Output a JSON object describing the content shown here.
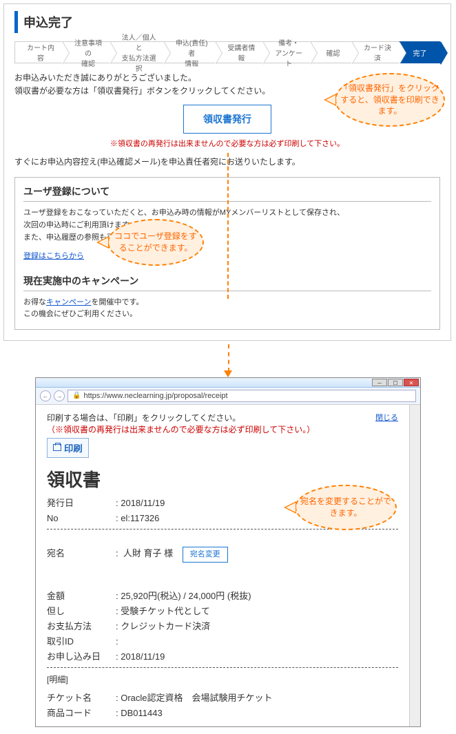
{
  "page": {
    "title": "申込完了"
  },
  "steps": [
    {
      "label": "カート内容"
    },
    {
      "label": "注意事項の\n確認"
    },
    {
      "label": "法人／個人と\n支払方法選択"
    },
    {
      "label": "申込(責任)者\n情報"
    },
    {
      "label": "受講者情報"
    },
    {
      "label": "備考・\nアンケート"
    },
    {
      "label": "確認"
    },
    {
      "label": "カード決済"
    },
    {
      "label": "完了"
    }
  ],
  "intro": {
    "line1": "お申込みいただき誠にありがとうございました。",
    "line2": "領収書が必要な方は「領収書発行」ボタンをクリックしてください。"
  },
  "issue_button": "領収書発行",
  "issue_caution": "※領収書の再発行は出来ませんので必要な方は必ず印刷して下さい。",
  "followup": "すぐにお申込内容控え(申込確認メール)を申込責任者宛にお送りいたします。",
  "user_reg": {
    "title": "ユーザ登録について",
    "body1": "ユーザ登録をおこなっていただくと、お申込み時の情報がMYメンバーリストとして保存され、",
    "body2": "次回の申込時にご利用頂けます。",
    "body3": "また、申込履歴の参照も可能です。",
    "link": "登録はこちらから"
  },
  "campaign": {
    "title": "現在実施中のキャンペーン",
    "body1_pre": "お得な",
    "body1_link": "キャンペーン",
    "body1_post": "を開催中です。",
    "body2": "この機会にぜひご利用ください。"
  },
  "bubble1": "「領収書発行」をクリックすると、領収書を印刷できます。",
  "bubble2": "ココでユーザ登録をすることができます。",
  "browser": {
    "url": "https://www.neclearning.jp/proposal/receipt",
    "close_label": "閉じる",
    "print_instruction": "印刷する場合は、「印刷」をクリックしてください。",
    "print_warn": "（※領収書の再発行は出来ませんので必要な方は必ず印刷して下さい。）",
    "print_btn": "印刷"
  },
  "receipt": {
    "title": "領収書",
    "issue_date_label": "発行日",
    "issue_date": "2018/11/19",
    "no_label": "No",
    "no": "el:117326",
    "name_label": "宛名",
    "name": "人財 育子 様",
    "change_name_btn": "宛名変更",
    "amount_label": "金額",
    "amount": "25,920円(税込) / 24,000円 (税抜)",
    "reason_label": "但し",
    "reason": "受験チケット代として",
    "paymethod_label": "お支払方法",
    "paymethod": "クレジットカード決済",
    "txid_label": "取引ID",
    "txid": "",
    "applydate_label": "お申し込み日",
    "applydate": "2018/11/19",
    "detail_header": "[明細]",
    "ticket_label": "チケット名",
    "ticket": "Oracle認定資格　会場試験用チケット",
    "code_label": "商品コード",
    "code": "DB011443"
  },
  "bubble3": "宛名を変更することができます。"
}
